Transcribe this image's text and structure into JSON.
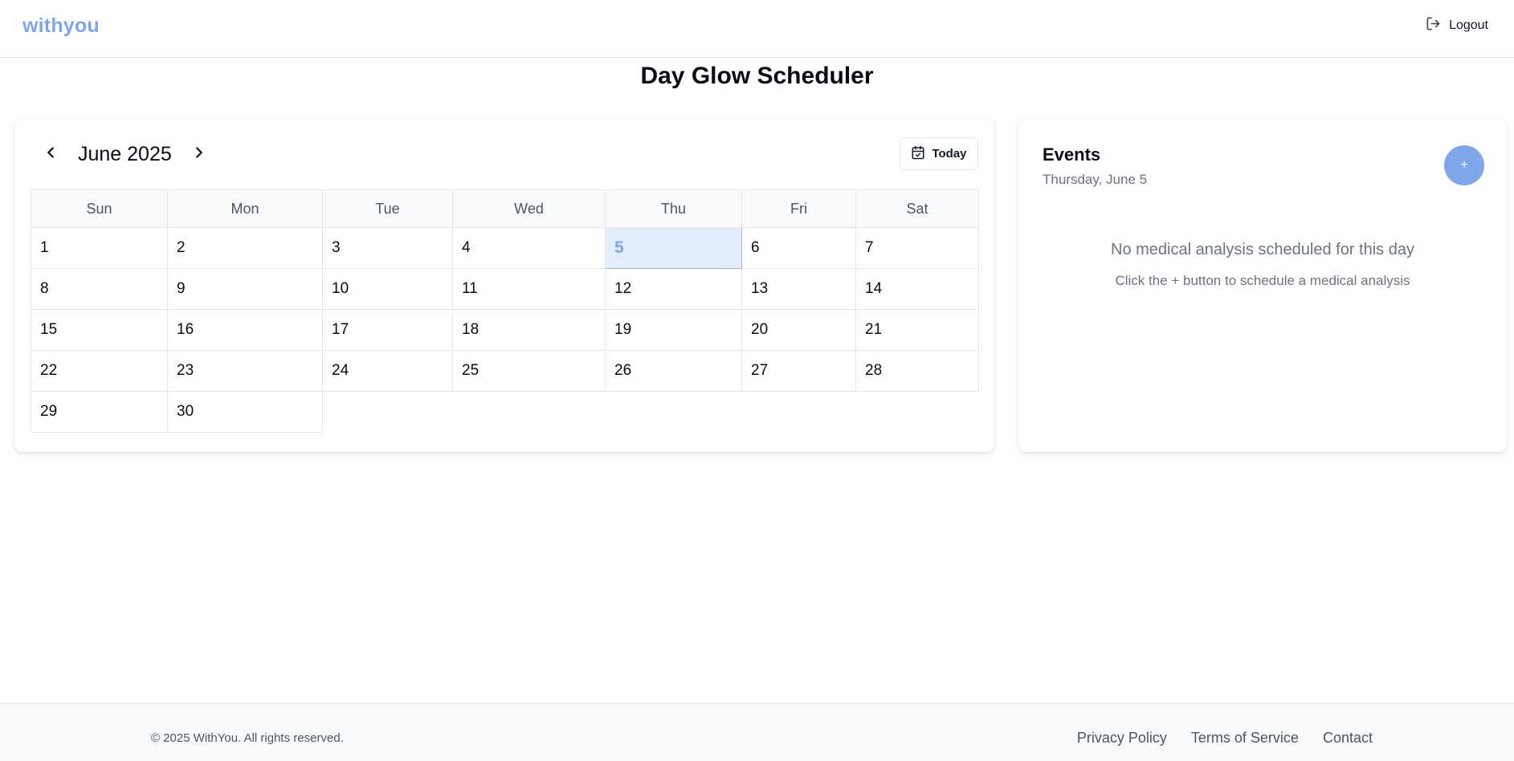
{
  "header": {
    "brand": "withyou",
    "logout_label": "Logout"
  },
  "page": {
    "title": "Day Glow Scheduler"
  },
  "calendar": {
    "month_label": "June 2025",
    "today_label": "Today",
    "weekdays": [
      "Sun",
      "Mon",
      "Tue",
      "Wed",
      "Thu",
      "Fri",
      "Sat"
    ],
    "weeks": [
      [
        "1",
        "2",
        "3",
        "4",
        "5",
        "6",
        "7"
      ],
      [
        "8",
        "9",
        "10",
        "11",
        "12",
        "13",
        "14"
      ],
      [
        "15",
        "16",
        "17",
        "18",
        "19",
        "20",
        "21"
      ],
      [
        "22",
        "23",
        "24",
        "25",
        "26",
        "27",
        "28"
      ],
      [
        "29",
        "30",
        "",
        "",
        "",
        "",
        ""
      ]
    ],
    "selected_day": "5"
  },
  "events": {
    "title": "Events",
    "selected_date": "Thursday, June 5",
    "add_label": "+",
    "empty_message": "No medical analysis scheduled for this day",
    "empty_hint": "Click the + button to schedule a medical analysis"
  },
  "footer": {
    "copyright": "© 2025 WithYou. All rights reserved.",
    "links": [
      "Privacy Policy",
      "Terms of Service",
      "Contact"
    ]
  },
  "colors": {
    "accent": "#7fa6ea",
    "selected_bg": "#e3ecfb"
  }
}
